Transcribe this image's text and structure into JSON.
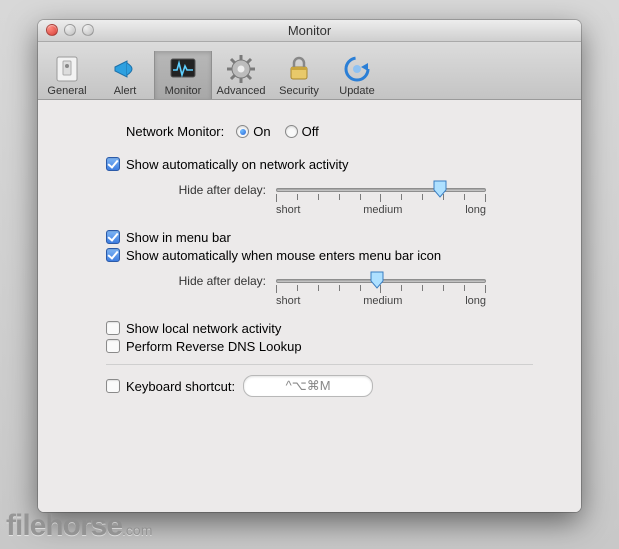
{
  "window": {
    "title": "Monitor"
  },
  "toolbar": [
    {
      "label": "General",
      "icon": "switch-icon",
      "selected": false
    },
    {
      "label": "Alert",
      "icon": "megaphone-icon",
      "selected": false
    },
    {
      "label": "Monitor",
      "icon": "monitor-icon",
      "selected": true
    },
    {
      "label": "Advanced",
      "icon": "gear-icon",
      "selected": false
    },
    {
      "label": "Security",
      "icon": "lock-icon",
      "selected": false
    },
    {
      "label": "Update",
      "icon": "refresh-icon",
      "selected": false
    }
  ],
  "networkMonitor": {
    "label": "Network Monitor:",
    "options": {
      "on": "On",
      "off": "Off"
    },
    "value": "on"
  },
  "options": {
    "showOnActivity": {
      "label": "Show automatically on network activity",
      "checked": true
    },
    "showInMenuBar": {
      "label": "Show in menu bar",
      "checked": true
    },
    "showOnHover": {
      "label": "Show automatically when mouse enters menu bar icon",
      "checked": true
    },
    "showLocal": {
      "label": "Show local network activity",
      "checked": false
    },
    "reverseDNS": {
      "label": "Perform Reverse DNS Lookup",
      "checked": false
    },
    "keyboardShortcut": {
      "label": "Keyboard shortcut:",
      "checked": false,
      "value": "^⌥⌘M"
    }
  },
  "sliders": {
    "label": "Hide after delay:",
    "ticks": {
      "short": "short",
      "medium": "medium",
      "long": "long"
    },
    "slider1": {
      "value": 78
    },
    "slider2": {
      "value": 48
    }
  },
  "watermark": {
    "brand": "filehorse",
    "suffix": ".com"
  }
}
